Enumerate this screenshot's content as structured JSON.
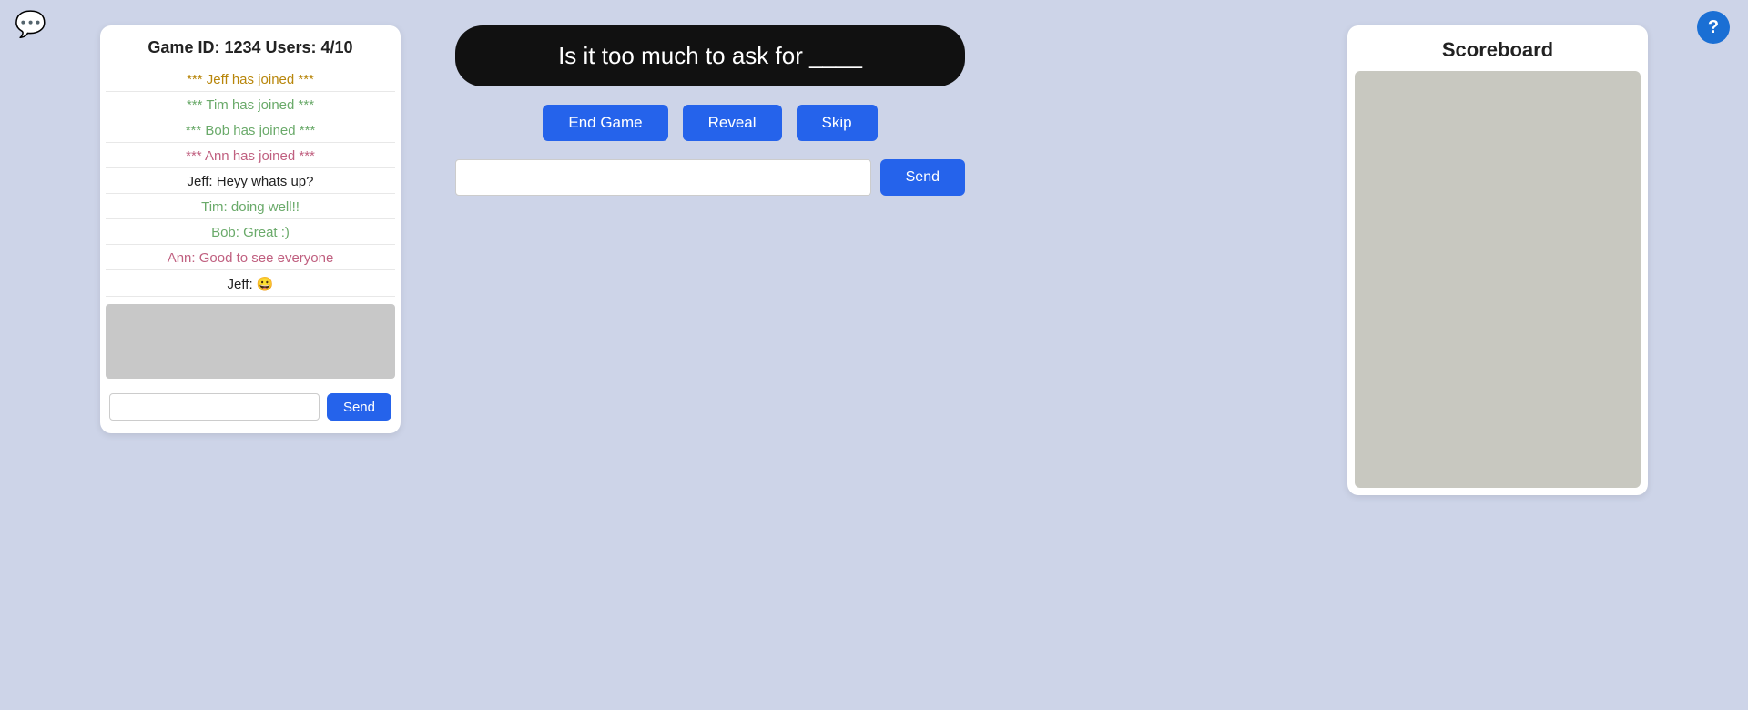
{
  "chat_icon": "💬",
  "help_icon": "?",
  "chat": {
    "header": "Game ID: 1234   Users: 4/10",
    "messages": [
      {
        "text": "*** Jeff has joined ***",
        "class": "msg-jeff-join"
      },
      {
        "text": "*** Tim has joined ***",
        "class": "msg-tim-join"
      },
      {
        "text": "*** Bob has joined ***",
        "class": "msg-bob-join"
      },
      {
        "text": "*** Ann has joined ***",
        "class": "msg-ann-join"
      },
      {
        "text": "Jeff: Heyy whats up?",
        "class": "msg-jeff"
      },
      {
        "text": "Tim: doing well!!",
        "class": "msg-tim"
      },
      {
        "text": "Bob: Great :)",
        "class": "msg-bob"
      },
      {
        "text": "Ann: Good to see everyone",
        "class": "msg-ann"
      },
      {
        "text": "Jeff: 😀",
        "class": "msg-jeff2"
      }
    ],
    "input_placeholder": "",
    "send_label": "Send"
  },
  "center": {
    "question": "Is it too much to ask for ____",
    "end_game_label": "End Game",
    "reveal_label": "Reveal",
    "skip_label": "Skip",
    "answer_placeholder": "",
    "send_label": "Send"
  },
  "scoreboard": {
    "title": "Scoreboard"
  }
}
